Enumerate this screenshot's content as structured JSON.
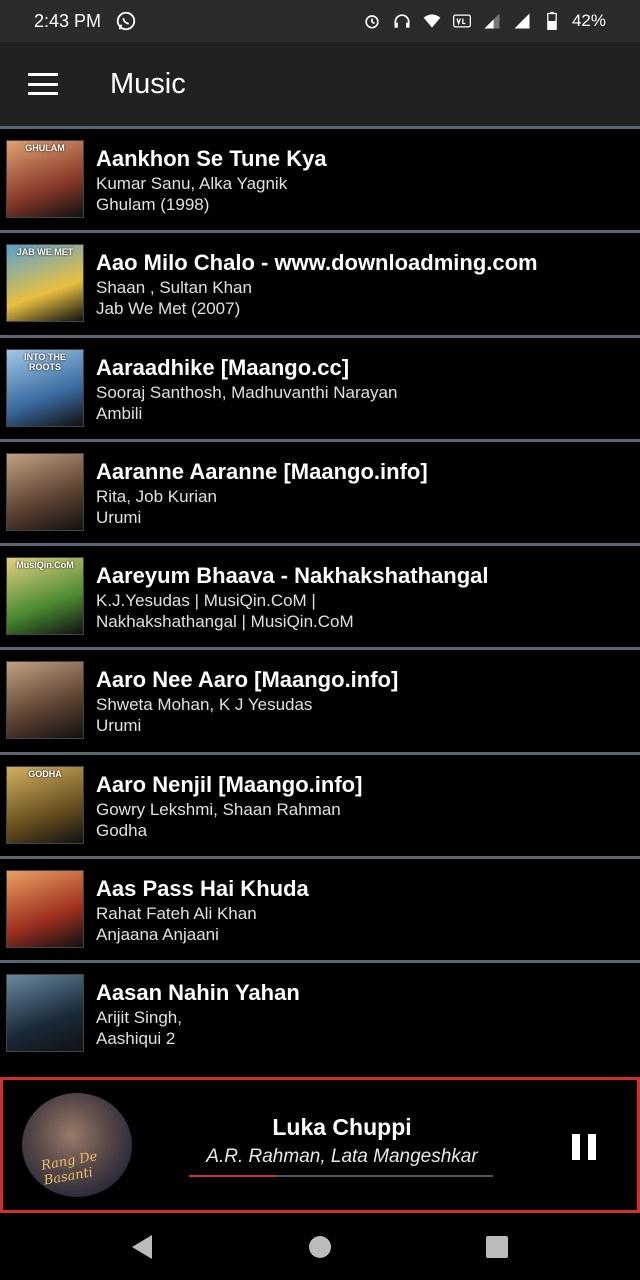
{
  "status_bar": {
    "time": "2:43 PM",
    "battery_percent": "42%",
    "icons": [
      "whatsapp-icon",
      "alarm-icon",
      "headphones-icon",
      "wifi-icon",
      "volte-icon",
      "signal-icon",
      "signal-icon-2",
      "battery-icon"
    ]
  },
  "app_bar": {
    "title": "Music"
  },
  "songs": [
    {
      "title": "Aankhon Se Tune Kya",
      "artist": "Kumar Sanu, Alka Yagnik",
      "album": "Ghulam (1998)",
      "cover_text": "GHULAM",
      "c1": "#8a3a2a",
      "c2": "#e0a070"
    },
    {
      "title": "Aao Milo Chalo - www.downloadming.com",
      "artist": "Shaan , Sultan Khan",
      "album": "Jab We Met (2007)",
      "cover_text": "JAB WE MET",
      "c1": "#e8c040",
      "c2": "#5aa0d0"
    },
    {
      "title": "Aaraadhike [Maango.cc]",
      "artist": "Sooraj Santhosh, Madhuvanthi Narayan",
      "album": "Ambili",
      "cover_text": "INTO THE ROOTS",
      "c1": "#3a6aa0",
      "c2": "#a0c8e8"
    },
    {
      "title": "Aaranne Aaranne [Maango.info]",
      "artist": "Rita, Job Kurian",
      "album": "Urumi",
      "cover_text": "",
      "c1": "#5a4030",
      "c2": "#c0a080"
    },
    {
      "title": "Aareyum Bhaava - Nakhakshathangal",
      "artist": "K.J.Yesudas | MusiQin.CoM |",
      "album": "Nakhakshathangal | MusiQin.CoM",
      "cover_text": "MusiQin.CoM",
      "c1": "#4a8a30",
      "c2": "#e0d080"
    },
    {
      "title": "Aaro Nee Aaro [Maango.info]",
      "artist": "Shweta Mohan, K J Yesudas",
      "album": "Urumi",
      "cover_text": "",
      "c1": "#5a4030",
      "c2": "#c0a080"
    },
    {
      "title": "Aaro Nenjil [Maango.info]",
      "artist": "Gowry Lekshmi, Shaan Rahman",
      "album": "Godha",
      "cover_text": "GODHA",
      "c1": "#6a5020",
      "c2": "#d0b060"
    },
    {
      "title": "Aas Pass Hai Khuda",
      "artist": "Rahat Fateh Ali Khan",
      "album": "Anjaana Anjaani",
      "cover_text": "",
      "c1": "#a03020",
      "c2": "#e8a060"
    },
    {
      "title": "Aasan Nahin Yahan",
      "artist": "Arijit Singh,",
      "album": "Aashiqui 2",
      "cover_text": "",
      "c1": "#1a2a3a",
      "c2": "#6a8aa0"
    }
  ],
  "now_playing": {
    "title": "Luka Chuppi",
    "artist": "A.R. Rahman, Lata Mangeshkar",
    "cover_text": "Rang De Basanti",
    "progress_fraction": 0.29,
    "accent_color": "#d32f2f"
  },
  "nav_bar": {
    "icons": [
      "back-icon",
      "home-icon",
      "recents-icon"
    ]
  }
}
